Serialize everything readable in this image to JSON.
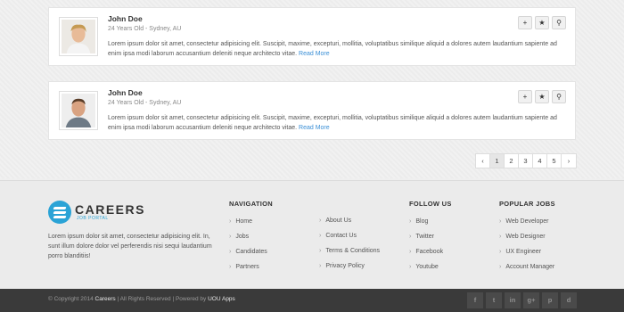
{
  "candidates": [
    {
      "name": "John Doe",
      "meta": "24 Years Old - Sydney, AU",
      "description": "Lorem ipsum dolor sit amet, consectetur adipisicing elit. Suscipit, maxime, excepturi, mollitia, voluptatibus similique aliquid a dolores autem laudantium sapiente ad enim ipsa modi laborum accusantium deleniti neque architecto vitae.",
      "read_more": "Read More"
    },
    {
      "name": "John Doe",
      "meta": "24 Years Old - Sydney, AU",
      "description": "Lorem ipsum dolor sit amet, consectetur adipisicing elit. Suscipit, maxime, excepturi, mollitia, voluptatibus similique aliquid a dolores autem laudantium sapiente ad enim ipsa modi laborum accusantium deleniti neque architecto vitae.",
      "read_more": "Read More"
    }
  ],
  "card_actions": {
    "add": "+",
    "star": "★",
    "link": "⚲"
  },
  "pagination": {
    "prev": "‹",
    "pages": [
      "1",
      "2",
      "3",
      "4",
      "5"
    ],
    "active": "1",
    "next": "›"
  },
  "footer": {
    "logo_title": "CAREERS",
    "logo_subtitle": "JOB PORTAL",
    "about": "Lorem ipsum dolor sit amet, consectetur adipisicing elit. In, sunt illum dolore dolor vel perferendis nisi sequi laudantium porro blanditiis!",
    "navigation": {
      "title": "NAVIGATION",
      "col1": [
        "Home",
        "Jobs",
        "Candidates",
        "Partners"
      ],
      "col2": [
        "About Us",
        "Contact Us",
        "Terms & Conditions",
        "Privacy Policy"
      ]
    },
    "follow": {
      "title": "FOLLOW US",
      "items": [
        "Blog",
        "Twitter",
        "Facebook",
        "Youtube"
      ]
    },
    "popular": {
      "title": "POPULAR JOBS",
      "items": [
        "Web Developer",
        "Web Designer",
        "UX Engineer",
        "Account Manager"
      ]
    },
    "copyright_prefix": "© Copyright 2014",
    "copyright_brand": "Careers",
    "copyright_mid": "| All Rights Reserved | Powered by",
    "copyright_powered": "UOU Apps",
    "social": [
      "f",
      "t",
      "in",
      "g+",
      "p",
      "d"
    ]
  },
  "colors": {
    "accent": "#2aa3d6",
    "link": "#3a8fd6",
    "bottom_bar": "#3a3a3a"
  },
  "icons": {
    "card_actions": [
      "plus-icon",
      "star-icon",
      "link-icon"
    ],
    "social": [
      "facebook-icon",
      "twitter-icon",
      "linkedin-icon",
      "google-plus-icon",
      "pinterest-icon",
      "dribbble-icon"
    ]
  }
}
